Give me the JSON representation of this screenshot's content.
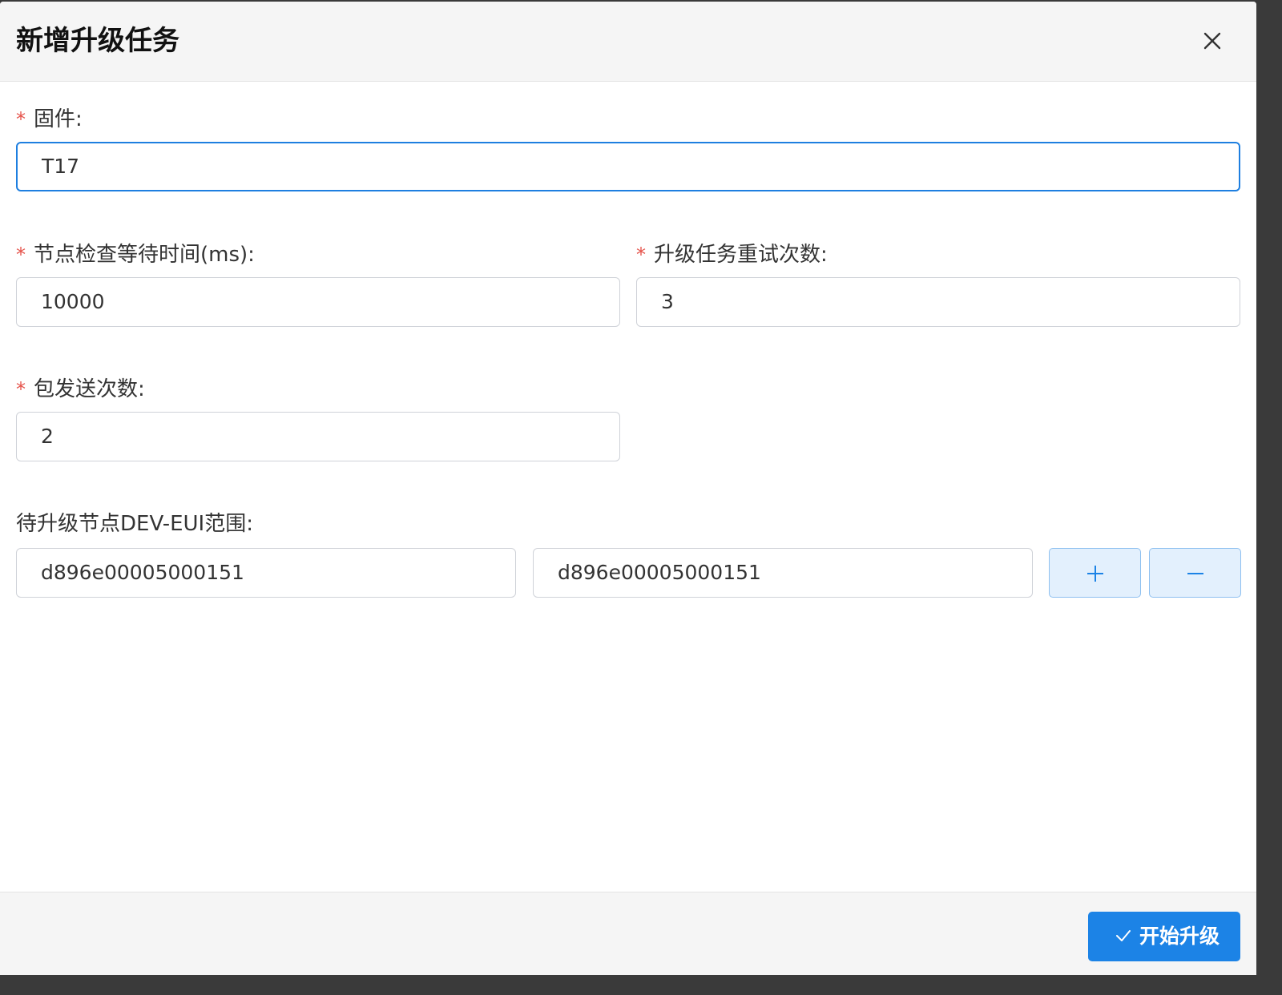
{
  "dialog": {
    "title": "新增升级任务",
    "close_icon": "close-icon"
  },
  "form": {
    "required_mark": "*",
    "firmware": {
      "label": "固件:",
      "value": "T17",
      "required": true
    },
    "node_check_wait": {
      "label": "节点检查等待时间(ms):",
      "value": "10000",
      "required": true
    },
    "task_retry_count": {
      "label": "升级任务重试次数:",
      "value": "3",
      "required": true
    },
    "packet_send_count": {
      "label": "包发送次数:",
      "value": "2",
      "required": true
    },
    "dev_eui_range": {
      "label": "待升级节点DEV-EUI范围:",
      "start_value": "d896e00005000151",
      "end_value": "d896e00005000151",
      "add_icon": "plus-icon",
      "remove_icon": "minus-icon"
    }
  },
  "footer": {
    "submit_label": "开始升级",
    "submit_icon": "check-icon"
  },
  "colors": {
    "accent": "#1c83e6",
    "required": "#e5534b",
    "focus_border": "#1e7fe0",
    "op_button_bg": "#e3f0fd"
  }
}
